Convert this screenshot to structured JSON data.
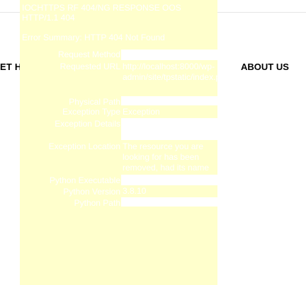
{
  "nav": {
    "left_label": "ET H",
    "right_label": "ABOUT US"
  },
  "error": {
    "title": "IOCHTTPS RF 404/NG RESPONSE OOS HTTP/1.1 404",
    "subtitle": "Error Summary: HTTP 404 Not Found",
    "rows": [
      {
        "label": "Request Method",
        "value": ""
      },
      {
        "label": "Requested URL",
        "value": "http://localhost:8000/wp-admin/site/tpstatic/index.php"
      },
      {
        "label": "Physical Path",
        "value": ""
      },
      {
        "label": "Exception Type",
        "value": "Exception"
      },
      {
        "label": "Exception Details",
        "value": ""
      },
      {
        "label": "Exception Location",
        "value": "The resource you are looking for has been removed, had its name changed"
      },
      {
        "label": "Python Executable",
        "value": ""
      },
      {
        "label": "Python Version",
        "value": "3.8.10"
      },
      {
        "label": "Python Path",
        "value": ""
      }
    ]
  }
}
